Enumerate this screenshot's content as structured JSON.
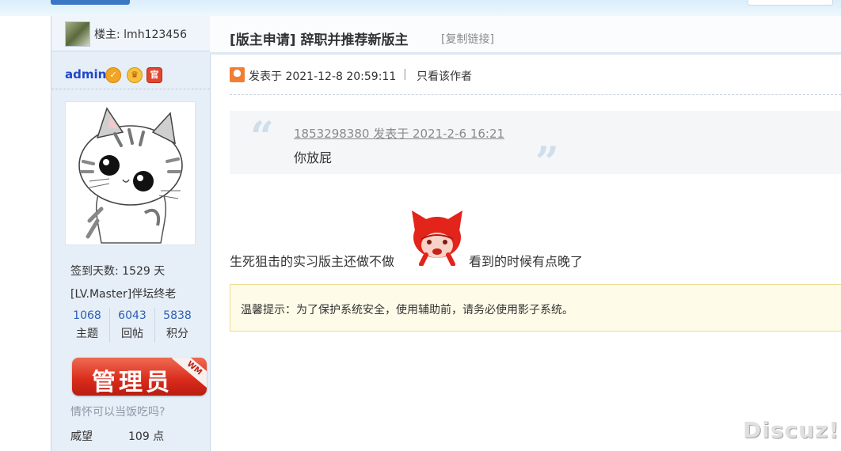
{
  "owner": {
    "label": "楼主: lmh123456"
  },
  "author": {
    "name": "admin",
    "signin_days": "签到天数: 1529 天",
    "rank": "[LV.Master]伴坛终老",
    "counts": [
      {
        "value": "1068",
        "label": "主题"
      },
      {
        "value": "6043",
        "label": "回帖"
      },
      {
        "value": "5838",
        "label": "积分"
      }
    ],
    "group_badge": "管理员",
    "group_badge_corner": "WM",
    "signature": "情怀可以当饭吃吗?",
    "prestige_label": "威望",
    "prestige_value": "109 点",
    "badges": [
      {
        "icon": "verified-icon",
        "glyph": "✓"
      },
      {
        "icon": "crown-medal-icon",
        "glyph": "♛"
      },
      {
        "icon": "official-badge-icon",
        "glyph": "官"
      }
    ]
  },
  "post": {
    "title": "[版主申请] 辞职并推荐新版主",
    "copy_link": "[复制链接]",
    "posted_at": "发表于 2021-12-8 20:59:11",
    "separator": "|",
    "author_only": "只看该作者",
    "quote": {
      "open_mark": "“",
      "close_mark": "”",
      "ref": "1853298380 发表于 2021-2-6 16:21",
      "body": "你放屁"
    },
    "body_before": "生死狙击的实习版主还做不做",
    "body_after": "看到的时候有点晚了",
    "emoji_icon": "red-fox-emoji-icon",
    "tip": "温馨提示：为了保护系统安全，使用辅助前，请务必使用影子系统。"
  },
  "watermark": "Discuz!",
  "colors": {
    "author_name": "#1e48c8",
    "count_number": "#2a5fb8",
    "badge_red": "#d82a1a",
    "tip_bg": "#fefbe8",
    "quote_mark": "#cfdeeb"
  }
}
